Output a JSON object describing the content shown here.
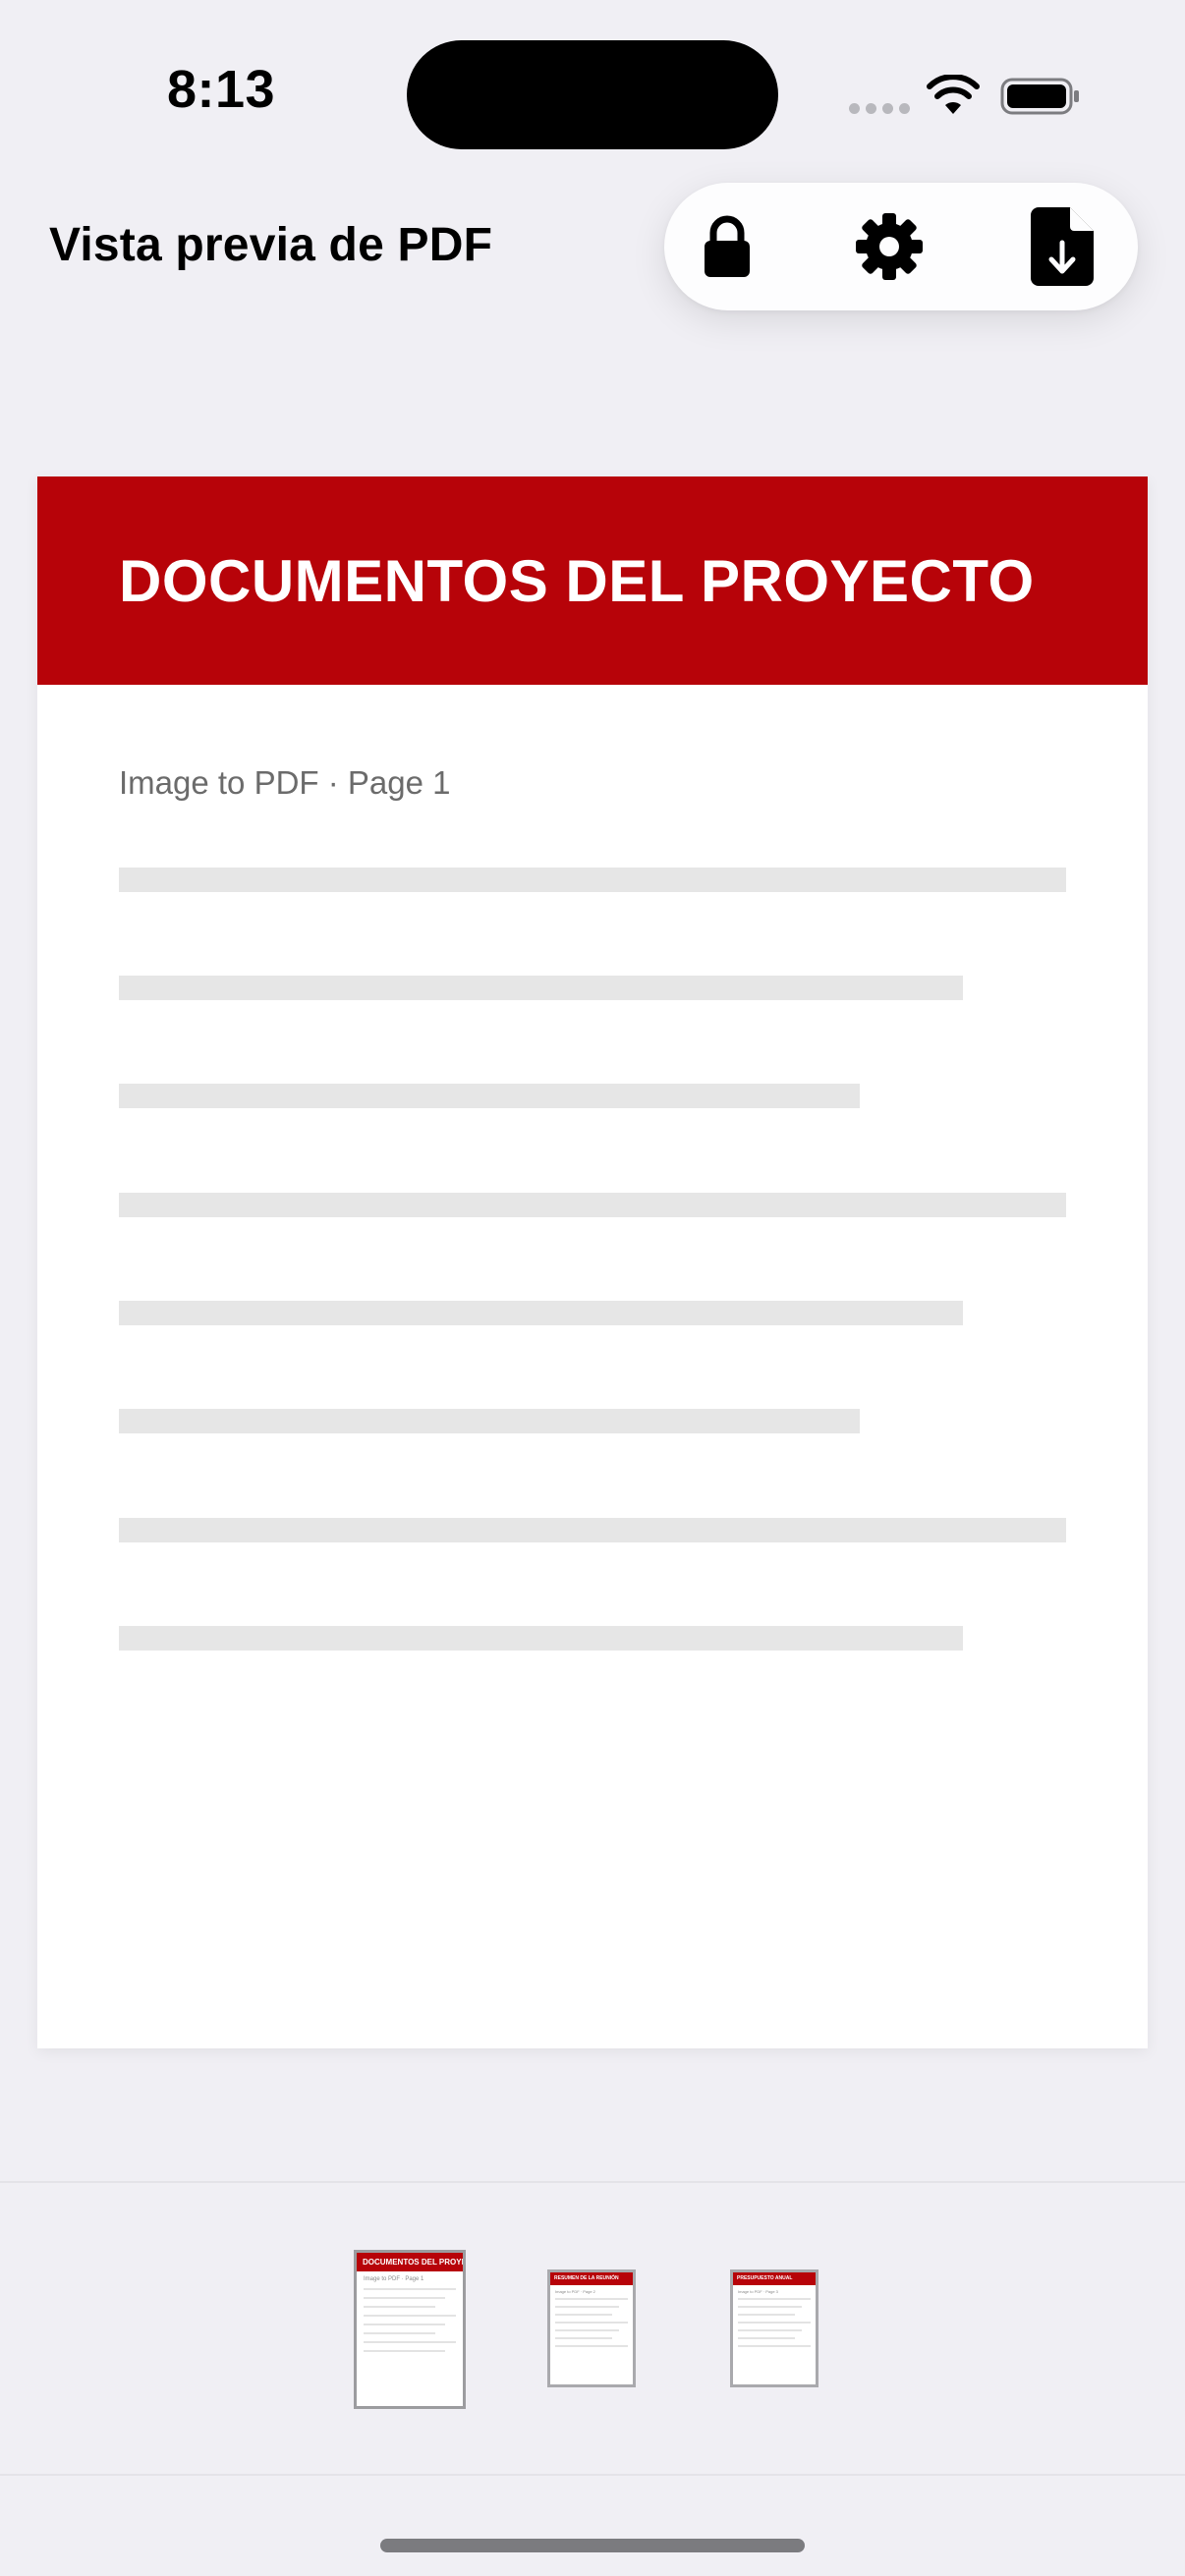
{
  "status_bar": {
    "time": "8:13"
  },
  "header": {
    "title": "Vista previa de PDF"
  },
  "toolbar": {
    "buttons": [
      {
        "icon": "lock-icon",
        "action": "lock"
      },
      {
        "icon": "gear-icon",
        "action": "settings"
      },
      {
        "icon": "document-download-icon",
        "action": "save"
      }
    ]
  },
  "pdf_page": {
    "header_title": "DOCUMENTOS DEL PROYECTO",
    "subtitle": "Image to PDF · Page 1",
    "header_color": "#b70309"
  },
  "thumbnails": [
    {
      "title": "DOCUMENTOS DEL PROYECTO",
      "subtitle": "Image to PDF · Page 1",
      "selected": true
    },
    {
      "title": "RESUMEN DE LA REUNIÓN",
      "subtitle": "Image to PDF · Page 2",
      "selected": false
    },
    {
      "title": "PRESUPUESTO ANUAL",
      "subtitle": "Image to PDF · Page 3",
      "selected": false
    }
  ],
  "colors": {
    "accent": "#b70309",
    "background": "#f0eff4",
    "placeholder_line": "#e6e6e6"
  }
}
